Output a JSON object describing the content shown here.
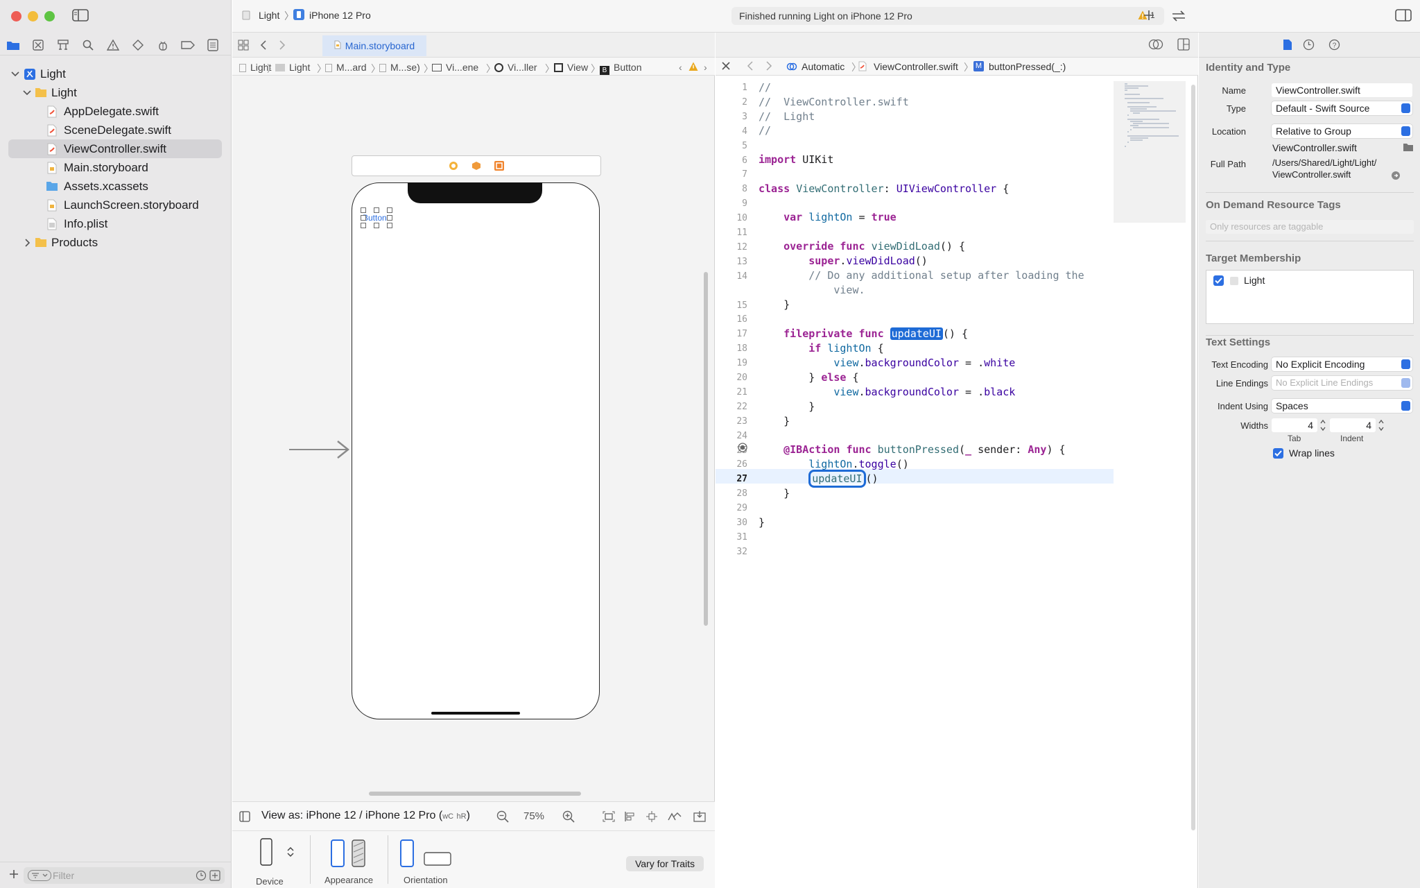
{
  "window": {
    "scheme": "Light",
    "destination": "iPhone 12 Pro",
    "activity_status": "Finished running Light on iPhone 12 Pro",
    "warning_count": "1"
  },
  "navigator": {
    "tree": [
      {
        "label": "Light",
        "kind": "project"
      },
      {
        "label": "Light",
        "kind": "folder"
      },
      {
        "label": "AppDelegate.swift",
        "kind": "swift"
      },
      {
        "label": "SceneDelegate.swift",
        "kind": "swift"
      },
      {
        "label": "ViewController.swift",
        "kind": "swift",
        "selected": true
      },
      {
        "label": "Main.storyboard",
        "kind": "storyboard"
      },
      {
        "label": "Assets.xcassets",
        "kind": "assets"
      },
      {
        "label": "LaunchScreen.storyboard",
        "kind": "storyboard"
      },
      {
        "label": "Info.plist",
        "kind": "plist"
      },
      {
        "label": "Products",
        "kind": "folder"
      }
    ],
    "filter_placeholder": "Filter"
  },
  "canvas_editor": {
    "tab_label": "Main.storyboard",
    "jumpbar": [
      "Light",
      "Light",
      "M...ard",
      "M...se)",
      "Vi...ene",
      "Vi...ller",
      "View",
      "Button"
    ],
    "button_text": "Button",
    "view_as": "View as: iPhone 12 / iPhone 12 Pro (",
    "size_class_w": "wC",
    "size_class_h": "hR",
    "view_as_close": ")",
    "zoom": "75%",
    "traits": {
      "device": "Device",
      "appearance": "Appearance",
      "orientation": "Orientation",
      "vary_button": "Vary for Traits"
    }
  },
  "code_editor": {
    "jumpbar": {
      "mode": "Automatic",
      "file": "ViewController.swift",
      "symbol_badge": "M",
      "symbol": "buttonPressed(_:)"
    },
    "current_line": 27,
    "line_numbers": [
      "1",
      "2",
      "3",
      "4",
      "5",
      "6",
      "7",
      "8",
      "9",
      "10",
      "11",
      "12",
      "13",
      "14",
      "",
      "15",
      "16",
      "17",
      "18",
      "19",
      "20",
      "21",
      "22",
      "23",
      "24",
      "25",
      "26",
      "27",
      "28",
      "29",
      "30",
      "31",
      "32"
    ]
  },
  "inspector": {
    "identity": {
      "title": "Identity and Type",
      "name_label": "Name",
      "name_value": "ViewController.swift",
      "type_label": "Type",
      "type_value": "Default - Swift Source",
      "location_label": "Location",
      "location_value": "Relative to Group",
      "location_file": "ViewController.swift",
      "fullpath_label": "Full Path",
      "fullpath_line1": "/Users/Shared/Light/Light/",
      "fullpath_line2": "ViewController.swift"
    },
    "tags": {
      "title": "On Demand Resource Tags",
      "placeholder": "Only resources are taggable"
    },
    "membership": {
      "title": "Target Membership",
      "target": "Light",
      "checked": true
    },
    "text_settings": {
      "title": "Text Settings",
      "encoding_label": "Text Encoding",
      "encoding_value": "No Explicit Encoding",
      "endings_label": "Line Endings",
      "endings_value": "No Explicit Line Endings",
      "indent_label": "Indent Using",
      "indent_value": "Spaces",
      "widths_label": "Widths",
      "tab_width": "4",
      "indent_width": "4",
      "tab_caption": "Tab",
      "indent_caption": "Indent",
      "wrap_label": "Wrap lines",
      "wrap_checked": true
    }
  },
  "colors": {
    "accent": "#2c6fe2",
    "keyword": "#9b2393",
    "type": "#3900a0",
    "comment": "#707f8c"
  }
}
